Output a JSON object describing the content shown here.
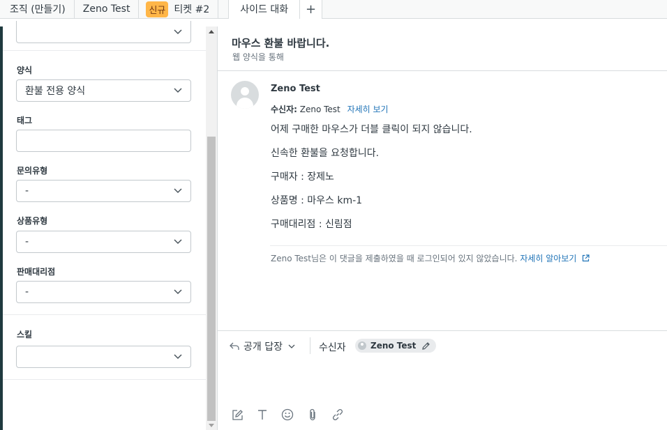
{
  "tabs": {
    "breadcrumb_org": "조직 (만들기)",
    "breadcrumb_user": "Zeno Test",
    "ticket_badge": "신규",
    "ticket_label": "티켓 #2",
    "side_conversation": "사이드 대화",
    "add_symbol": "+"
  },
  "left_panel": {
    "fields": [
      {
        "label": "양식",
        "value": "환불 전용 양식"
      },
      {
        "label": "태그",
        "value": ""
      },
      {
        "label": "문의유형",
        "value": "-"
      },
      {
        "label": "상품유형",
        "value": "-"
      },
      {
        "label": "판매대리점",
        "value": "-"
      },
      {
        "label": "스킬",
        "value": ""
      }
    ]
  },
  "ticket": {
    "subject": "마우스 환불 바랍니다.",
    "via": "웹 양식을 통해"
  },
  "message": {
    "author": "Zeno Test",
    "recipient_label": "수신자:",
    "recipient_name": "Zeno Test",
    "details_link": "자세히 보기",
    "lines": [
      "어제 구매한 마우스가 더블 클릭이 되지 않습니다.",
      "신속한 환불을 요청합니다.",
      "구매자 : 장제노",
      "상품명 : 마우스 km-1",
      "구매대리점 : 신림점"
    ],
    "notice_text": "Zeno Test님은 이 댓글을 제출하였을 때 로그인되어 있지 않았습니다.",
    "notice_link": "자세히 알아보기"
  },
  "reply": {
    "type_label": "공개 답장",
    "to_label": "수신자",
    "recipient_chip": "Zeno Test"
  },
  "icons": {
    "reply": "reply-arrow-icon",
    "compose": "compose-icon",
    "text": "text-format-icon",
    "emoji": "emoji-icon",
    "attach": "paperclip-icon",
    "link": "link-icon"
  },
  "colors": {
    "badge_bg": "#ffb648",
    "link": "#1f73b7",
    "border": "#d8dcde"
  }
}
